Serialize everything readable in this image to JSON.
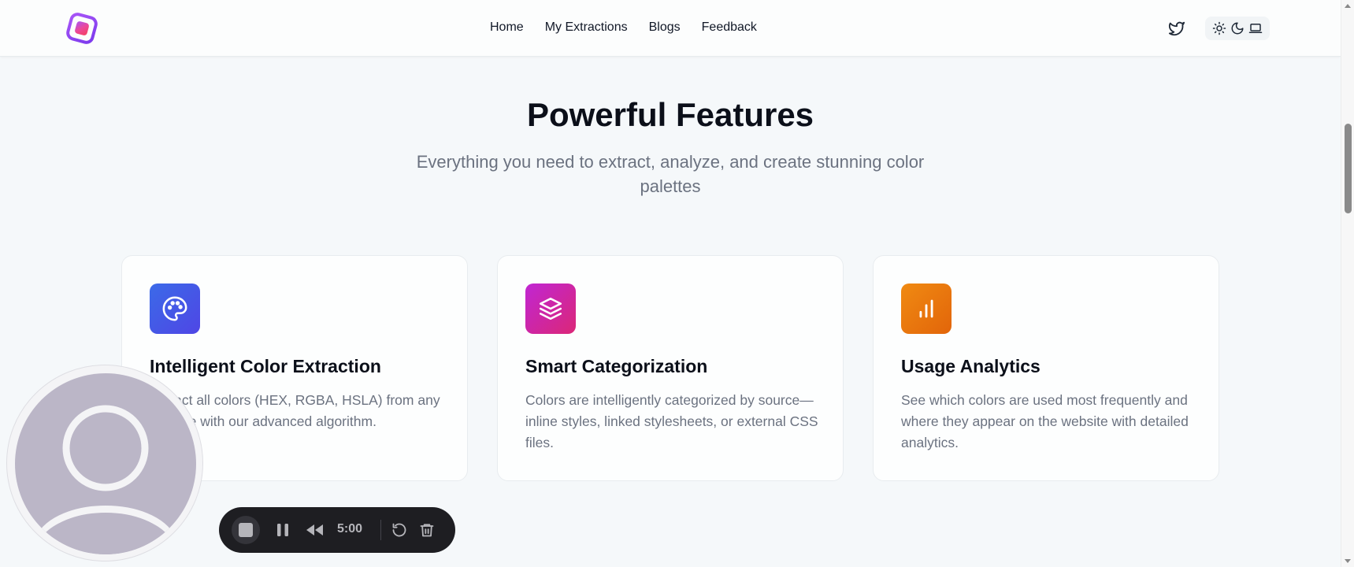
{
  "header": {
    "nav": [
      "Home",
      "My Extractions",
      "Blogs",
      "Feedback"
    ],
    "icons": {
      "logo": "app-logo",
      "social": "twitter-icon",
      "theme": [
        "sun-icon",
        "moon-icon",
        "laptop-icon"
      ]
    }
  },
  "section": {
    "title": "Powerful Features",
    "subtitle": "Everything you need to extract, analyze, and create stunning color palettes"
  },
  "features": [
    {
      "icon": "palette-icon",
      "title": "Intelligent Color Extraction",
      "description": "Extract all colors (HEX, RGBA, HSLA) from any website with our advanced algorithm."
    },
    {
      "icon": "layers-icon",
      "title": "Smart Categorization",
      "description": "Colors are intelligently categorized by source—inline styles, linked stylesheets, or external CSS files."
    },
    {
      "icon": "bar-chart-icon",
      "title": "Usage Analytics",
      "description": "See which colors are used most frequently and where they appear on the website with detailed analytics."
    }
  ],
  "recorder": {
    "time": "5:00",
    "icons": [
      "stop-icon",
      "pause-icon",
      "rewind-icon",
      "restart-icon",
      "trash-icon"
    ]
  },
  "colors": {
    "card1_icon_bg": "#4f46e5",
    "card2_icon_bg": "#c026d3",
    "card3_icon_bg": "#ea7a0f",
    "avatar_bg": "#bbb6c7"
  }
}
